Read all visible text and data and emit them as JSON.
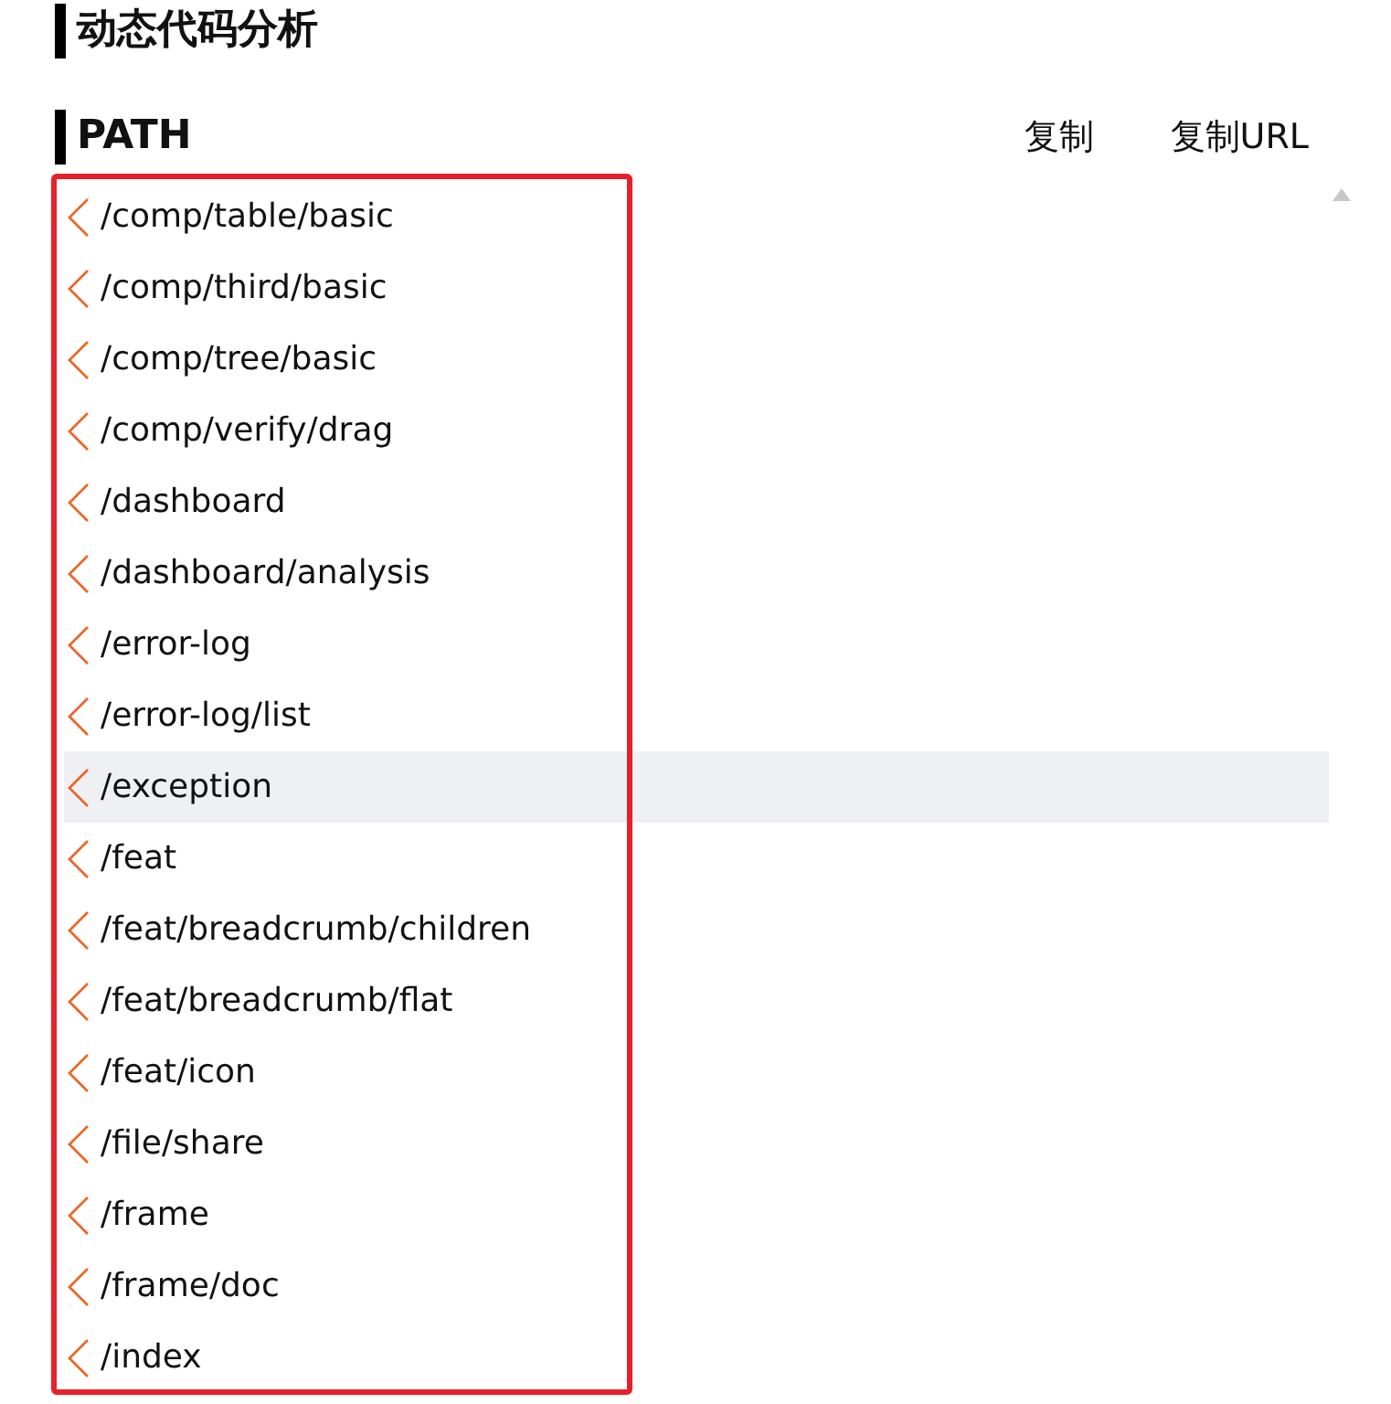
{
  "title": "动态代码分析",
  "section": {
    "title": "PATH",
    "actions": [
      "复制",
      "复制URL"
    ]
  },
  "paths": [
    {
      "text": "/comp/table/basic",
      "selected": false
    },
    {
      "text": "/comp/third/basic",
      "selected": false
    },
    {
      "text": "/comp/tree/basic",
      "selected": false
    },
    {
      "text": "/comp/verify/drag",
      "selected": false
    },
    {
      "text": "/dashboard",
      "selected": false
    },
    {
      "text": "/dashboard/analysis",
      "selected": false
    },
    {
      "text": "/error-log",
      "selected": false
    },
    {
      "text": "/error-log/list",
      "selected": false
    },
    {
      "text": "/exception",
      "selected": true
    },
    {
      "text": "/feat",
      "selected": false
    },
    {
      "text": "/feat/breadcrumb/children",
      "selected": false
    },
    {
      "text": "/feat/breadcrumb/flat",
      "selected": false
    },
    {
      "text": "/feat/icon",
      "selected": false
    },
    {
      "text": "/file/share",
      "selected": false
    },
    {
      "text": "/frame",
      "selected": false
    },
    {
      "text": "/frame/doc",
      "selected": false
    },
    {
      "text": "/index",
      "selected": false
    }
  ]
}
